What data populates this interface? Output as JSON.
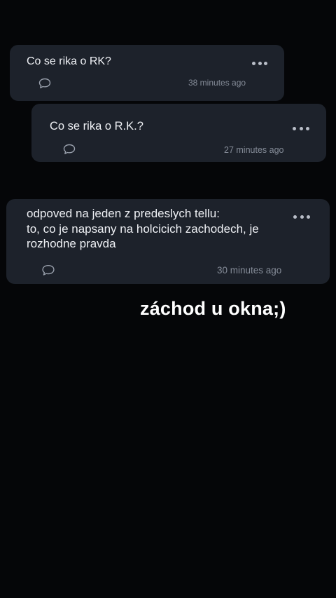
{
  "posts": [
    {
      "text": "Co se rika o RK?",
      "time": "38 minutes ago"
    },
    {
      "text": "Co se rika o R.K.?",
      "time": "27 minutes ago"
    },
    {
      "text": "odpoved na jeden z predeslych tellu:\nto, co je napsany na holcicich zachodech, je\nrozhodne pravda",
      "time": "30 minutes ago"
    }
  ],
  "caption": "záchod u okna;)",
  "icons": {
    "more": "more-dots-icon",
    "comment": "comment-bubble-icon"
  },
  "colors": {
    "background": "#050608",
    "card": "#1d222b",
    "text": "#eef0f4",
    "muted": "#858c98"
  }
}
